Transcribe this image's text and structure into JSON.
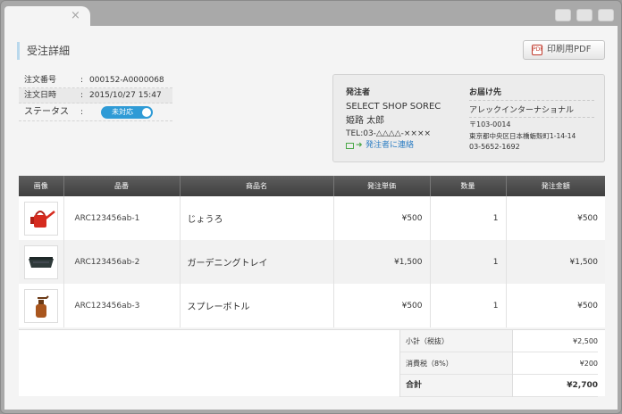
{
  "page": {
    "title": "受注詳細",
    "pdf_button": "印刷用PDF",
    "tab_close": "×"
  },
  "order": {
    "number_label": "注文番号",
    "number": "000152-A0000068",
    "date_label": "注文日時",
    "date": "2015/10/27 15:47",
    "status_label": "ステータス",
    "separator": ":",
    "status": "未対応"
  },
  "sender": {
    "heading": "発注者",
    "shop": "SELECT SHOP SOREC",
    "person": "姫路 太郎",
    "tel": "TEL:03-△△△△-××××",
    "contact_link": "発注者に連絡"
  },
  "destination": {
    "heading": "お届け先",
    "name": "アレックインターナショナル",
    "postal": "〒103-0014",
    "address": "東京都中央区日本橋蛎殻町1-14-14",
    "phone": "03-5652-1692"
  },
  "table": {
    "headers": [
      "画像",
      "品番",
      "商品名",
      "発注単価",
      "数量",
      "発注金額"
    ],
    "rows": [
      {
        "code": "ARC123456ab-1",
        "name": "じょうろ",
        "price": "¥500",
        "qty": "1",
        "amount": "¥500",
        "image_icon": "watering-can-icon"
      },
      {
        "code": "ARC123456ab-2",
        "name": "ガーデニングトレイ",
        "price": "¥1,500",
        "qty": "1",
        "amount": "¥1,500",
        "image_icon": "garden-tray-icon"
      },
      {
        "code": "ARC123456ab-3",
        "name": "スプレーボトル",
        "price": "¥500",
        "qty": "1",
        "amount": "¥500",
        "image_icon": "spray-bottle-icon"
      }
    ]
  },
  "summary": {
    "subtotal_label": "小計（税抜）",
    "subtotal": "¥2,500",
    "tax_label": "消費税（8%）",
    "tax": "¥200",
    "total_label": "合計",
    "total": "¥2,700"
  },
  "colors": {
    "status_toggle": "#2f9bd6",
    "link": "#2f7fc4",
    "contact_icon": "#4ba848",
    "header_bg": "#4a4a4a"
  }
}
